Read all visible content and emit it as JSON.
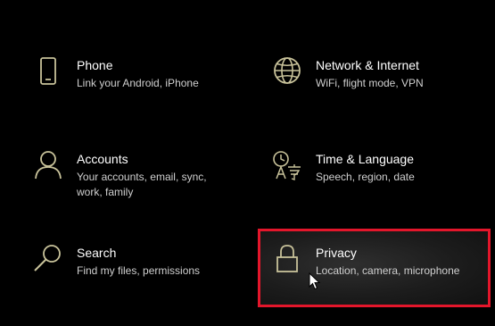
{
  "colors": {
    "background": "#000000",
    "icon_accent": "#c8c29a",
    "title_text": "#ffffff",
    "desc_text": "#cfcfcf",
    "highlight_border": "#e3162b"
  },
  "tiles": [
    {
      "id": "phone",
      "icon": "phone-icon",
      "title": "Phone",
      "desc": [
        "Link your Android, iPhone"
      ]
    },
    {
      "id": "network",
      "icon": "globe-icon",
      "title": "Network & Internet",
      "desc": [
        "WiFi, flight mode, VPN"
      ]
    },
    {
      "id": "accounts",
      "icon": "person-icon",
      "title": "Accounts",
      "desc": [
        "Your accounts, email, sync,",
        "work, family"
      ]
    },
    {
      "id": "time",
      "icon": "time-language-icon",
      "title": "Time & Language",
      "desc": [
        "Speech, region, date"
      ]
    },
    {
      "id": "search",
      "icon": "search-icon",
      "title": "Search",
      "desc": [
        "Find my files, permissions"
      ]
    },
    {
      "id": "privacy",
      "icon": "lock-icon",
      "title": "Privacy",
      "desc": [
        "Location, camera, microphone"
      ],
      "highlighted": true
    }
  ]
}
